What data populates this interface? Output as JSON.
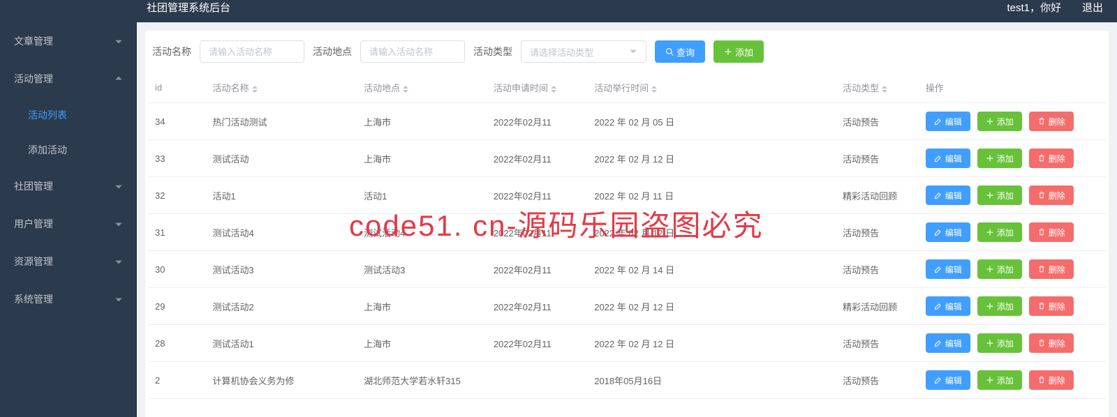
{
  "header": {
    "title": "社团管理系统后台",
    "greeting": "test1，你好",
    "logout": "退出"
  },
  "sidebar": {
    "items": [
      {
        "label": "文章管理",
        "expanded": false
      },
      {
        "label": "活动管理",
        "expanded": true,
        "children": [
          {
            "label": "活动列表",
            "active": true
          },
          {
            "label": "添加活动",
            "active": false
          }
        ]
      },
      {
        "label": "社团管理",
        "expanded": false
      },
      {
        "label": "用户管理",
        "expanded": false
      },
      {
        "label": "资源管理",
        "expanded": false
      },
      {
        "label": "系统管理",
        "expanded": false
      }
    ]
  },
  "search": {
    "name_label": "活动名称",
    "name_placeholder": "请输入活动名称",
    "loc_label": "活动地点",
    "loc_placeholder": "请输入活动名称",
    "type_label": "活动类型",
    "type_placeholder": "请选择活动类型",
    "query_btn": "查询",
    "add_btn": "添加"
  },
  "table": {
    "headers": {
      "id": "id",
      "name": "活动名称",
      "loc": "活动地点",
      "apply": "活动申请时间",
      "hold": "活动举行时间",
      "type": "活动类型",
      "ops": "操作"
    },
    "ops": {
      "edit": "编辑",
      "add": "添加",
      "delete": "删除"
    },
    "rows": [
      {
        "id": "34",
        "name": "热门活动测试",
        "loc": "上海市",
        "apply": "2022年02月11",
        "hold": "2022 年 02 月 05 日",
        "type": "活动预告"
      },
      {
        "id": "33",
        "name": "测试活动",
        "loc": "上海市",
        "apply": "2022年02月11",
        "hold": "2022 年 02 月 12 日",
        "type": "活动预告"
      },
      {
        "id": "32",
        "name": "活动1",
        "loc": "活动1",
        "apply": "2022年02月11",
        "hold": "2022 年 02 月 11 日",
        "type": "精彩活动回顾"
      },
      {
        "id": "31",
        "name": "测试活动4",
        "loc": "测试活动4",
        "apply": "2022年02月11",
        "hold": "2022 年 02 月 12 日",
        "type": "活动预告"
      },
      {
        "id": "30",
        "name": "测试活动3",
        "loc": "测试活动3",
        "apply": "2022年02月11",
        "hold": "2022 年 02 月 14 日",
        "type": "活动预告"
      },
      {
        "id": "29",
        "name": "测试活动2",
        "loc": "上海市",
        "apply": "2022年02月11",
        "hold": "2022 年 02 月 12 日",
        "type": "精彩活动回顾"
      },
      {
        "id": "28",
        "name": "测试活动1",
        "loc": "上海市",
        "apply": "2022年02月11",
        "hold": "2022 年 02 月 12 日",
        "type": "活动预告"
      },
      {
        "id": "2",
        "name": "计算机协会义务为修",
        "loc": "湖北师范大学若水轩315",
        "apply": "",
        "hold": "2018年05月16日",
        "type": "活动预告"
      }
    ]
  },
  "watermark": "code51. cn-源码乐园盗图必究"
}
